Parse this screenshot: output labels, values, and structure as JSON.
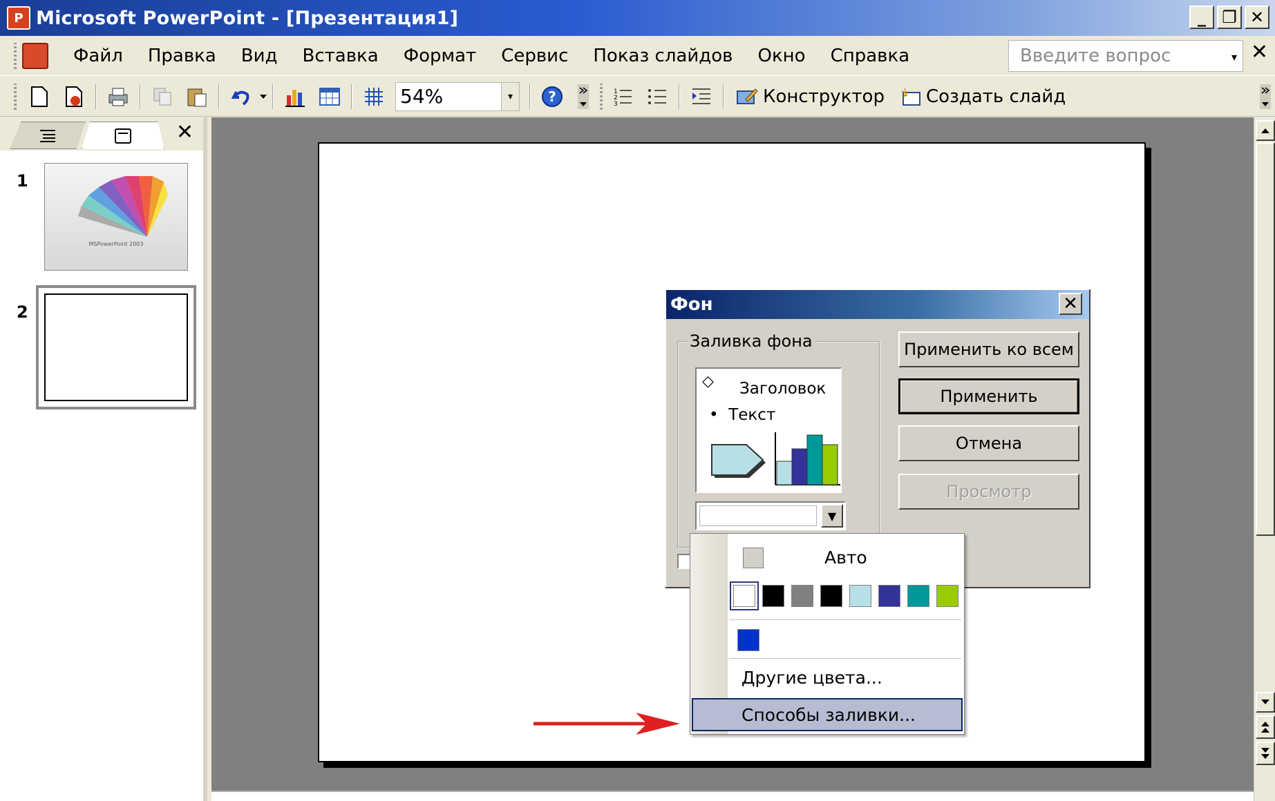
{
  "window": {
    "app_icon_glyph": "P",
    "title": "Microsoft PowerPoint - [Презентация1]",
    "minimize": "_",
    "restore": "❐",
    "close": "✕"
  },
  "menubar": {
    "items": [
      "Файл",
      "Правка",
      "Вид",
      "Вставка",
      "Формат",
      "Сервис",
      "Показ слайдов",
      "Окно",
      "Справка"
    ],
    "help_placeholder": "Введите вопрос",
    "help_arrow": "▾",
    "close_glyph": "✕"
  },
  "toolbar": {
    "zoom": "54%",
    "zoom_arrow": "▾",
    "design_label": "Конструктор",
    "new_slide_label": "Создать слайд"
  },
  "left_panel": {
    "close_glyph": "✕",
    "slides": [
      {
        "number": "1",
        "title": "MSPowerPoint 2003"
      },
      {
        "number": "2"
      }
    ]
  },
  "dialog": {
    "title": "Фон",
    "close_glyph": "✕",
    "group_label": "Заливка фона",
    "preview_title": "Заголовок",
    "preview_text": "Текст",
    "preview_bullet": "•",
    "preview_diamond": "◇",
    "combo_arrow": "▼",
    "buttons": {
      "apply_all": "Применить ко всем",
      "apply": "Применить",
      "cancel": "Отмена",
      "preview": "Просмотр"
    }
  },
  "color_menu": {
    "auto_label": "Авто",
    "more_colors": "Другие цвета...",
    "fill_effects": "Способы заливки...",
    "swatches": [
      "#ffffff",
      "#000000",
      "#808080",
      "#000000",
      "#b7e0e6",
      "#333399",
      "#009999",
      "#99cc00"
    ],
    "extra_swatch": "#0033cc"
  },
  "colors": {
    "title_gradient_start": "#1a3e96",
    "dialog_bg": "#d4d0c8",
    "workspace_bg": "#808080",
    "annotation_arrow": "#e02020"
  }
}
